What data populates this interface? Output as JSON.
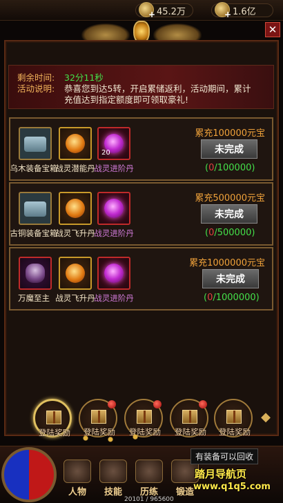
{
  "currencies": [
    {
      "value": "45.2万",
      "icon": "coin-stack-icon"
    },
    {
      "value": "1.6亿",
      "icon": "gold-ingot-icon"
    }
  ],
  "info": {
    "time_label": "剩余时间:",
    "time_value": "32分11秒",
    "desc_label": "活动说明:",
    "desc_line1": "恭喜您到达5转，开启累储返利，活动期间，累计",
    "desc_line2": "充值达到指定额度即可领取豪礼!"
  },
  "tiers": [
    {
      "goal": "累充100000元宝",
      "status": "未完成",
      "progress_current": "0",
      "progress_total": "/100000)",
      "items": [
        {
          "name": "乌木装备宝箱",
          "type": "chest"
        },
        {
          "name": "战灵潜能丹",
          "type": "gold"
        },
        {
          "name": "战灵进阶丹",
          "type": "pink",
          "count": "20"
        }
      ]
    },
    {
      "goal": "累充500000元宝",
      "status": "未完成",
      "progress_current": "0",
      "progress_total": "/500000)",
      "items": [
        {
          "name": "古铜装备宝箱",
          "type": "chest"
        },
        {
          "name": "战灵飞升丹",
          "type": "gold"
        },
        {
          "name": "战灵进阶丹",
          "type": "pink"
        }
      ]
    },
    {
      "goal": "累充1000000元宝",
      "status": "未完成",
      "progress_current": "0",
      "progress_total": "/1000000)",
      "items": [
        {
          "name": "万魔至主",
          "type": "demon"
        },
        {
          "name": "战灵飞升丹",
          "type": "gold"
        },
        {
          "name": "战灵进阶丹",
          "type": "pink"
        }
      ]
    }
  ],
  "gifts": [
    "登陆奖励",
    "登陆奖励",
    "登陆奖励",
    "登陆奖励",
    "登陆奖励"
  ],
  "nav": [
    "人物",
    "技能",
    "历练",
    "锻造"
  ],
  "tooltip": "有装备可以回收",
  "exp": "20101 / 965600",
  "watermark_line1": "踏月导航页",
  "watermark_line2": "www.q1q5.com"
}
